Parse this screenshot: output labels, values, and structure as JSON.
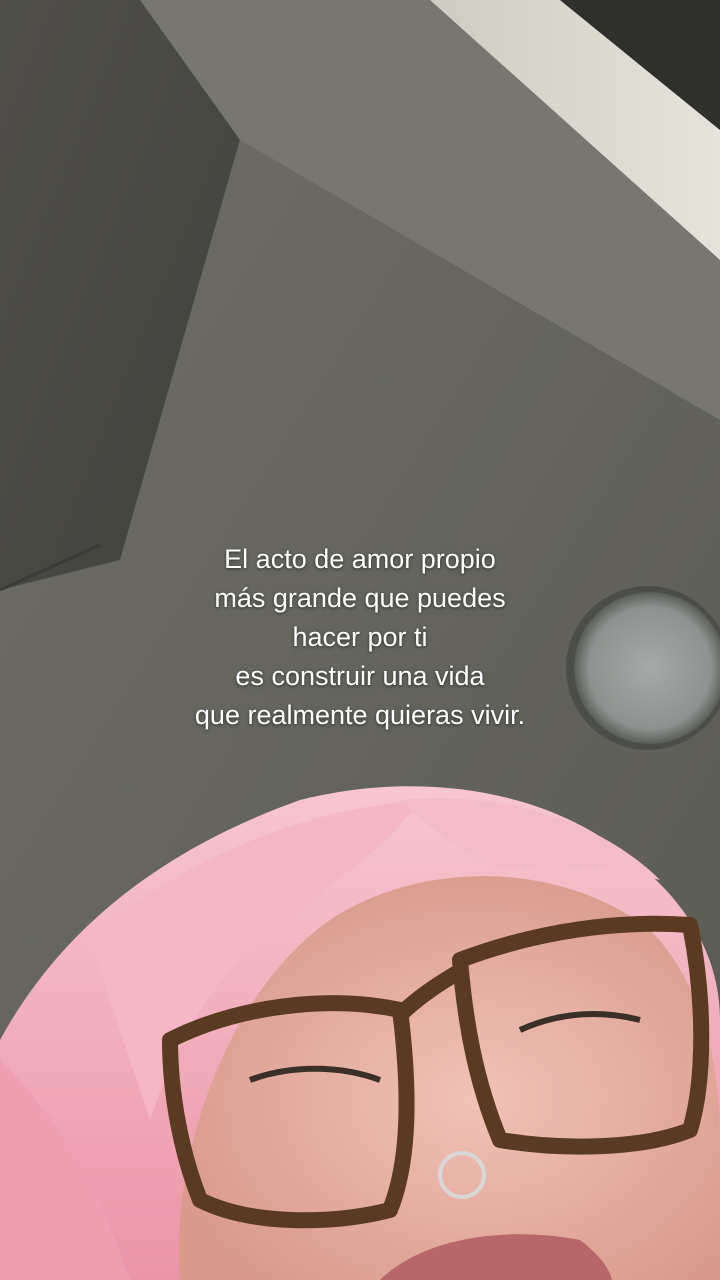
{
  "caption": {
    "lines": [
      "El acto de amor propio",
      "más grande que puedes",
      "hacer por ti",
      "es construir una vida",
      "que realmente quieras vivir."
    ]
  },
  "colors": {
    "wall": "#5d5c57",
    "ceiling_light": "#d9d6cc",
    "hair": "#f2a9b8",
    "skin": "#e9b5a8",
    "glasses_frame": "#5a3a22",
    "caption_text": "#ffffff"
  }
}
